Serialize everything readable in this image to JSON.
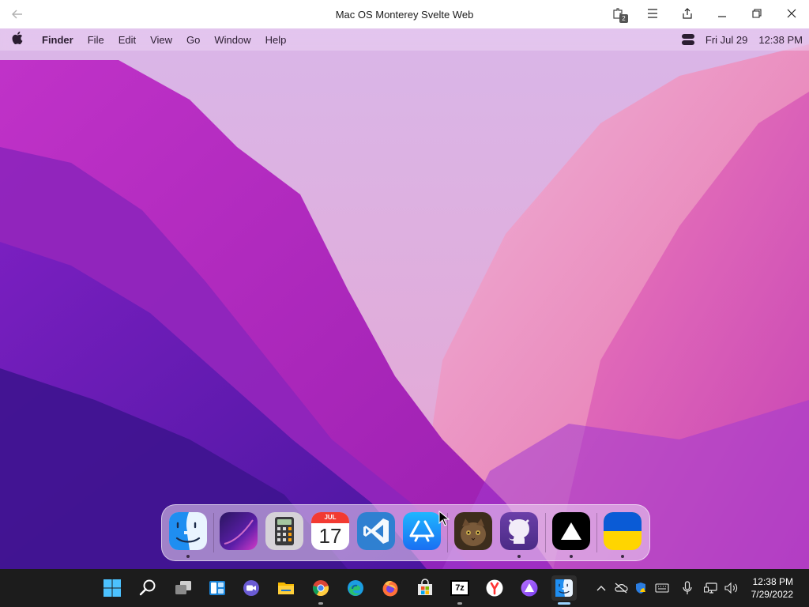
{
  "window": {
    "title": "Mac OS Monterey Svelte Web",
    "back_icon": "back-arrow-icon",
    "extensions_badge": "2",
    "controls": [
      "extensions-icon",
      "menu-icon",
      "share-icon",
      "minimize-icon",
      "restore-icon",
      "close-icon"
    ]
  },
  "menubar": {
    "apple_glyph": "",
    "items": [
      "Finder",
      "File",
      "Edit",
      "View",
      "Go",
      "Window",
      "Help"
    ],
    "date": "Fri Jul 29",
    "time": "12:38 PM"
  },
  "dock": {
    "apps": [
      {
        "name": "finder",
        "icon": "finder-icon",
        "running": true
      },
      {
        "name": "launchpad",
        "icon": "launchpad-icon",
        "running": false
      },
      {
        "name": "calculator",
        "icon": "calculator-icon",
        "running": false
      },
      {
        "name": "calendar",
        "icon": "calendar-icon",
        "running": false,
        "month": "JUL",
        "day": "17"
      },
      {
        "name": "vscode",
        "icon": "vscode-icon",
        "running": false
      },
      {
        "name": "app-store",
        "icon": "app-store-icon",
        "running": false
      },
      {
        "name": "cat-photo",
        "icon": "cat-photo-icon",
        "running": false
      },
      {
        "name": "github",
        "icon": "github-icon",
        "running": true
      },
      {
        "name": "vercel",
        "icon": "vercel-icon",
        "running": true
      },
      {
        "name": "ukraine",
        "icon": "ukraine-flag-icon",
        "running": true
      }
    ]
  },
  "taskbar": {
    "apps": [
      "windows-start-icon",
      "search-icon",
      "task-view-icon",
      "widgets-icon",
      "teams-chat-icon",
      "file-explorer-icon",
      "chrome-icon",
      "edge-icon",
      "firefox-icon",
      "microsoft-store-icon",
      "7zip-icon",
      "yandex-icon",
      "alice-icon",
      "finder-app-icon"
    ],
    "sevenzip_label": "7z",
    "tray": [
      "chevron-up-icon",
      "cloud-off-icon",
      "defender-icon",
      "keyboard-icon",
      "microphone-icon",
      "network-icon",
      "volume-icon"
    ],
    "time": "12:38 PM",
    "date": "7/29/2022"
  },
  "colors": {
    "wallpaper_top": "#c98de0",
    "wallpaper_mid": "#b04ec6",
    "wallpaper_bottom": "#4c1a9e",
    "taskbar_bg": "#1c1c1c"
  }
}
